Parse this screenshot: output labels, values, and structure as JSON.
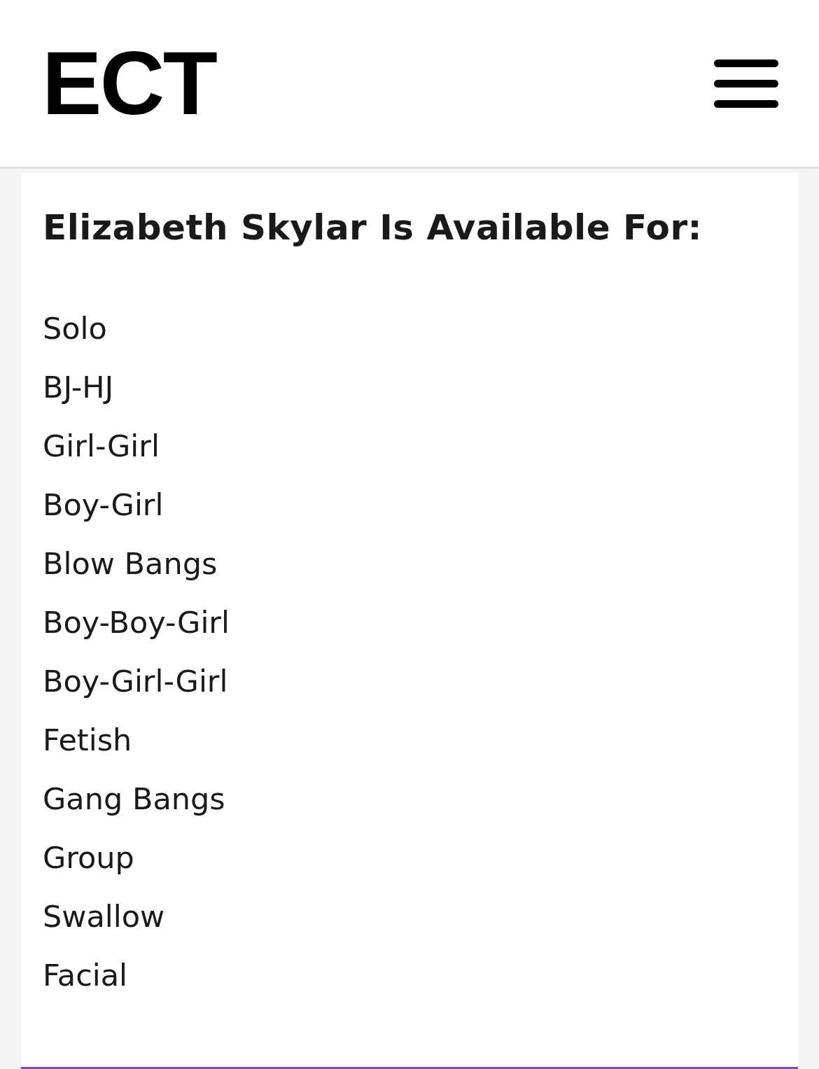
{
  "header": {
    "logo": "ECT"
  },
  "card": {
    "title": "Elizabeth Skylar Is Available For:",
    "items": [
      "Solo",
      "BJ-HJ",
      "Girl-Girl",
      "Boy-Girl",
      "Blow Bangs",
      "Boy-Boy-Girl",
      "Boy-Girl-Girl",
      "Fetish",
      "Gang Bangs",
      "Group",
      "Swallow",
      "Facial"
    ]
  }
}
